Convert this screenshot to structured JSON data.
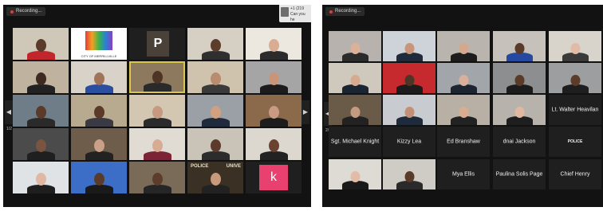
{
  "left_window": {
    "recording_label": "Recording...",
    "notification": {
      "line1": "+1 (219",
      "line2": "Can you he"
    },
    "tile_letters": {
      "p": "P",
      "k": "k"
    },
    "logo_text": "CITY OF MERRILLVILLE",
    "police_sign": "POLICE",
    "univ_sign": "UNIVE",
    "page_indicator": "1/2"
  },
  "right_window": {
    "recording_label": "Recording...",
    "page_indicator": "2/2",
    "police_tile_text": "POLICE",
    "names": {
      "walter": "Lt. Walter Heavilan",
      "knight": "Sgt. Michael Knight",
      "kizzy": "Kizzy Lea",
      "branshaw": "Ed Branshaw",
      "jackson": "dnai Jackson",
      "ellis": "Mya Ellis",
      "solis": "Paulina Solis Page",
      "henry": "Chief Henry"
    }
  },
  "colors": {
    "tile_bg": "#1f1f1f",
    "active_speaker_border": "#d9c84a",
    "k_tile": "#e8416f",
    "p_tile": "#4a4238",
    "red_wall": "#c62a2f"
  }
}
